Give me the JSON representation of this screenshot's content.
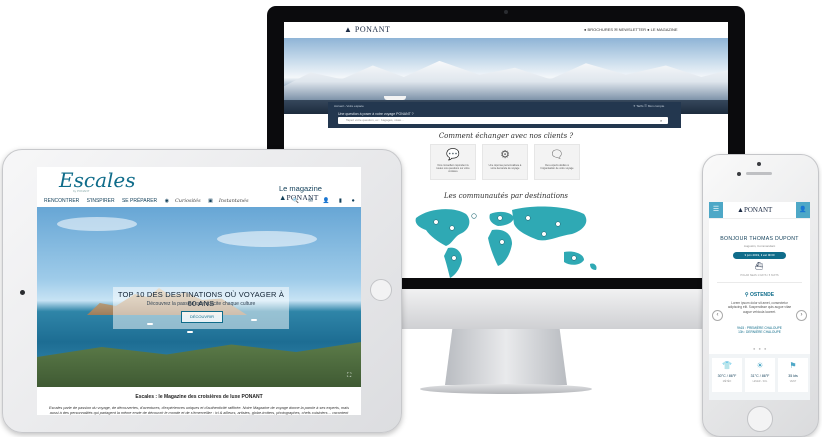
{
  "desktop": {
    "brand": "PONANT",
    "nav": "● BROCHURES  ✉ NEWSLETTER  ● LE MAGAZINE",
    "search": {
      "hint": "Accueil  ›  Votre espace",
      "question": "Une question à poser à votre voyage PONANT ?",
      "links": "✈ Tarifs  ☰ Mon compte",
      "placeholder": "Tapez votre question, ex : bagages, visas..."
    },
    "heading": "Comment échanger avec nos clients ?",
    "cards": [
      {
        "icon": "chat-bubble-icon",
        "glyph": "💬",
        "text": "Nos conseillers répondent à toutes vos questions sur votre croisière"
      },
      {
        "icon": "gears-icon",
        "glyph": "⚙",
        "text": "Une réponse personnalisée à votre demande de voyage"
      },
      {
        "icon": "people-chat-icon",
        "glyph": "🗨",
        "text": "Des experts dédiés à l'organisation de votre voyage"
      }
    ],
    "map_heading": "Les communautés par destinations",
    "colors": {
      "panel": "#23374f",
      "map": "#2fa9b4"
    }
  },
  "tablet": {
    "logo": "Escales",
    "logo_sub": "by PONANT",
    "nav": [
      "RENCONTRER",
      "S'INSPIRER",
      "SE PRÉPARER",
      "Curiosités",
      "Instantanés"
    ],
    "magazine_label": "Le magazine",
    "magazine_brand": "PONANT",
    "icons": "🔍 ✉ 👤 ▮ ●",
    "hero": {
      "title": "TOP 10 DES DESTINATIONS OÙ VOYAGER À 60 ANS",
      "subtitle": "Découvrez la passion que suscite chaque culture",
      "button": "DÉCOUVRIR"
    },
    "caption_title": "Escales : le Magazine des croisières de luxe PONANT",
    "body": "Escales parle de passion du voyage, de découvertes, d'aventures, d'expériences uniques et d'authenticité raffinée. Notre Magazine de voyage donne la parole à ses experts, mais aussi à des personnalités qui partagent la même envie de découvrir le monde et de s'émerveiller : ici & ailleurs, artistes, globe-trotters, photographes, chefs cuisiniers… racontent ces paysages à couper le souffle, ces rencontres hors-normes, ces moments inoubliables. Galeries, sélections, tops, curiosités & instantanés : autant de rendez-vous pour vous donner des idées de voyage et vous aider à préparer votre prochaine expédition. Pour vous inspirer, toujours et encore."
  },
  "phone": {
    "brand": "PONANT",
    "greeting": "BONJOUR THOMAS DUPONT",
    "greeting_sub": "Augustin, Commandant",
    "pill": "3 juin 2019, il est 9h30",
    "ship_sub": "POLAR SEAS 1 DAYS / 5 NUITS",
    "port": "OSTENDE",
    "lorem": "Lorem ipsum dolor sit amet, consectetur adipiscing elit. Suspendisse quis augue vitae augue vehicula laoreet.",
    "first_tender": "9h15 : PREMIÈRE CHALOUPE",
    "last_tender": "13h : DERNIÈRE CHALOUPE",
    "tiles": [
      {
        "icon": "shirt-icon",
        "glyph": "👕",
        "value": "30°C / 86°F",
        "label": "MÉTÉO"
      },
      {
        "icon": "sun-icon",
        "glyph": "☀",
        "value": "31°C / 86°F",
        "label": "LEVER - SOL"
      },
      {
        "icon": "flag-icon",
        "glyph": "⚑",
        "value": "35 kts",
        "label": "VENT"
      }
    ]
  }
}
